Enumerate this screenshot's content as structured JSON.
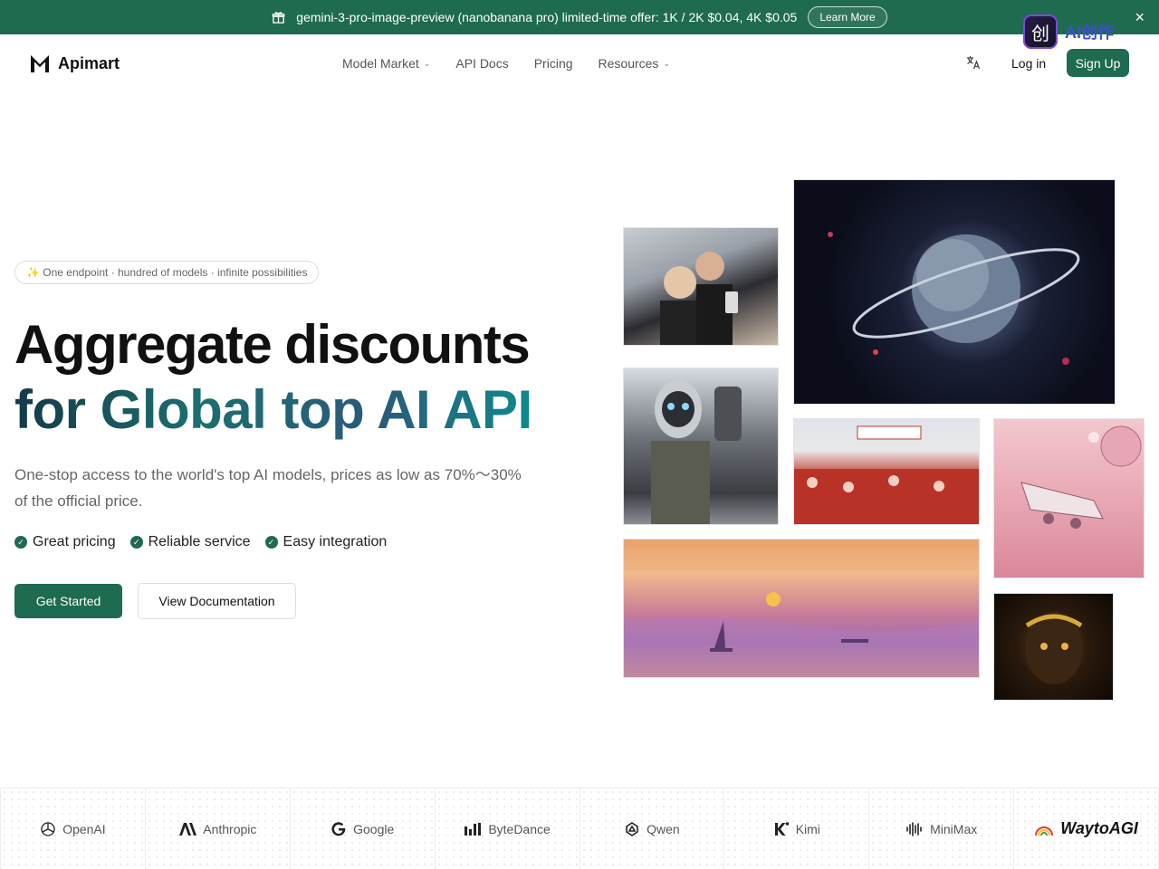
{
  "banner": {
    "text": "gemini-3-pro-image-preview (nanobanana pro) limited-time offer: 1K / 2K $0.04, 4K $0.05",
    "cta": "Learn More",
    "close": "×"
  },
  "watermark": {
    "badge": "创",
    "text": "AI创作"
  },
  "nav": {
    "logo": "Apimart",
    "items": [
      {
        "label": "Model Market",
        "dropdown": true
      },
      {
        "label": "API Docs",
        "dropdown": false
      },
      {
        "label": "Pricing",
        "dropdown": false
      },
      {
        "label": "Resources",
        "dropdown": true
      }
    ],
    "login": "Log in",
    "signup": "Sign Up"
  },
  "hero": {
    "pill": "✨ One endpoint · hundred of models · infinite possibilities",
    "title_line1": "Aggregate discounts",
    "title_line2": "for Global top AI API",
    "subtitle": "One-stop access to the world's top AI models, prices as low as 70%～30% of the official price.",
    "features": [
      "Great pricing",
      "Reliable service",
      "Easy integration"
    ],
    "primary_button": "Get Started",
    "secondary_button": "View Documentation"
  },
  "brands": [
    "OpenAI",
    "Anthropic",
    "Google",
    "ByteDance",
    "Qwen",
    "Kimi",
    "MiniMax",
    "WaytoAGI"
  ],
  "colors": {
    "accent": "#1f6b4f",
    "banner": "#1f6b4f"
  }
}
